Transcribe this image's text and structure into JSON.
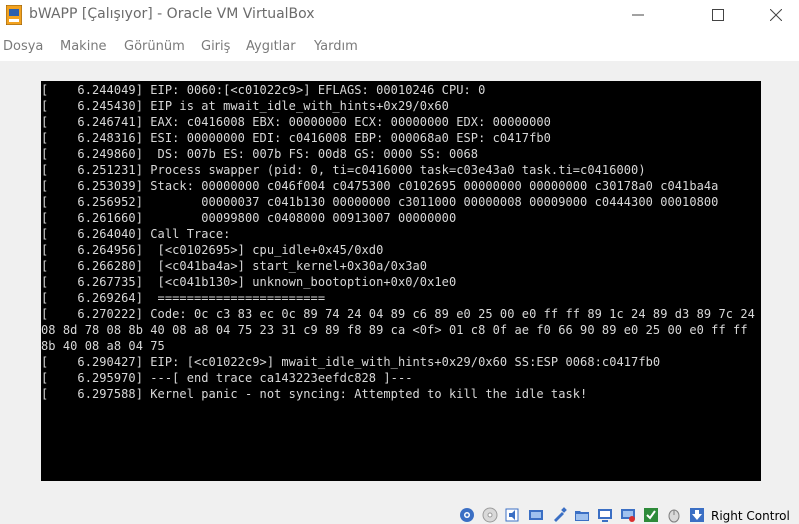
{
  "window": {
    "title": "bWAPP [Çalışıyor] - Oracle VM VirtualBox"
  },
  "menu": {
    "items": [
      "Dosya",
      "Makine",
      "Görünüm",
      "Giriş",
      "Aygıtlar",
      "Yardım"
    ]
  },
  "console": {
    "lines": [
      "[    6.244049] EIP: 0060:[<c01022c9>] EFLAGS: 00010246 CPU: 0",
      "[    6.245430] EIP is at mwait_idle_with_hints+0x29/0x60",
      "[    6.246741] EAX: c0416008 EBX: 00000000 ECX: 00000000 EDX: 00000000",
      "[    6.248316] ESI: 00000000 EDI: c0416008 EBP: 000068a0 ESP: c0417fb0",
      "[    6.249860]  DS: 007b ES: 007b FS: 00d8 GS: 0000 SS: 0068",
      "[    6.251231] Process swapper (pid: 0, ti=c0416000 task=c03e43a0 task.ti=c0416000)",
      "[    6.253039] Stack: 00000000 c046f004 c0475300 c0102695 00000000 00000000 c30178a0 c041ba4a",
      "[    6.256952]        00000037 c041b130 00000000 c3011000 00000008 00009000 c0444300 00010800",
      "[    6.261660]        00099800 c0408000 00913007 00000000",
      "[    6.264040] Call Trace:",
      "[    6.264956]  [<c0102695>] cpu_idle+0x45/0xd0",
      "[    6.266280]  [<c041ba4a>] start_kernel+0x30a/0x3a0",
      "[    6.267735]  [<c041b130>] unknown_bootoption+0x0/0x1e0",
      "[    6.269264]  =======================",
      "[    6.270222] Code: 0c c3 83 ec 0c 89 74 24 04 89 c6 89 e0 25 00 e0 ff ff 89 1c 24 89 d3 89 7c 24 08 8d 78 08 8b 40 08 a8 04 75 23 31 c9 89 f8 89 ca <0f> 01 c8 0f ae f0 66 90 89 e0 25 00 e0 ff ff 8b 40 08 a8 04 75",
      "[    6.290427] EIP: [<c01022c9>] mwait_idle_with_hints+0x29/0x60 SS:ESP 0068:c0417fb0",
      "[    6.295970] ---[ end trace ca143223eefdc828 ]---",
      "[    6.297588] Kernel panic - not syncing: Attempted to kill the idle task!"
    ]
  },
  "statusbar": {
    "host_key": "Right Control",
    "icons": [
      "hard-disk-icon",
      "optical-drive-icon",
      "audio-icon",
      "network-icon",
      "usb-icon",
      "shared-folders-icon",
      "display-icon",
      "video-capture-icon",
      "guest-additions-icon",
      "mouse-integration-icon",
      "host-key-arrow-icon"
    ]
  },
  "colors": {
    "console_bg": "#000000",
    "console_text": "#d8d8d8",
    "vm_area_bg": "#f0f0f0"
  }
}
